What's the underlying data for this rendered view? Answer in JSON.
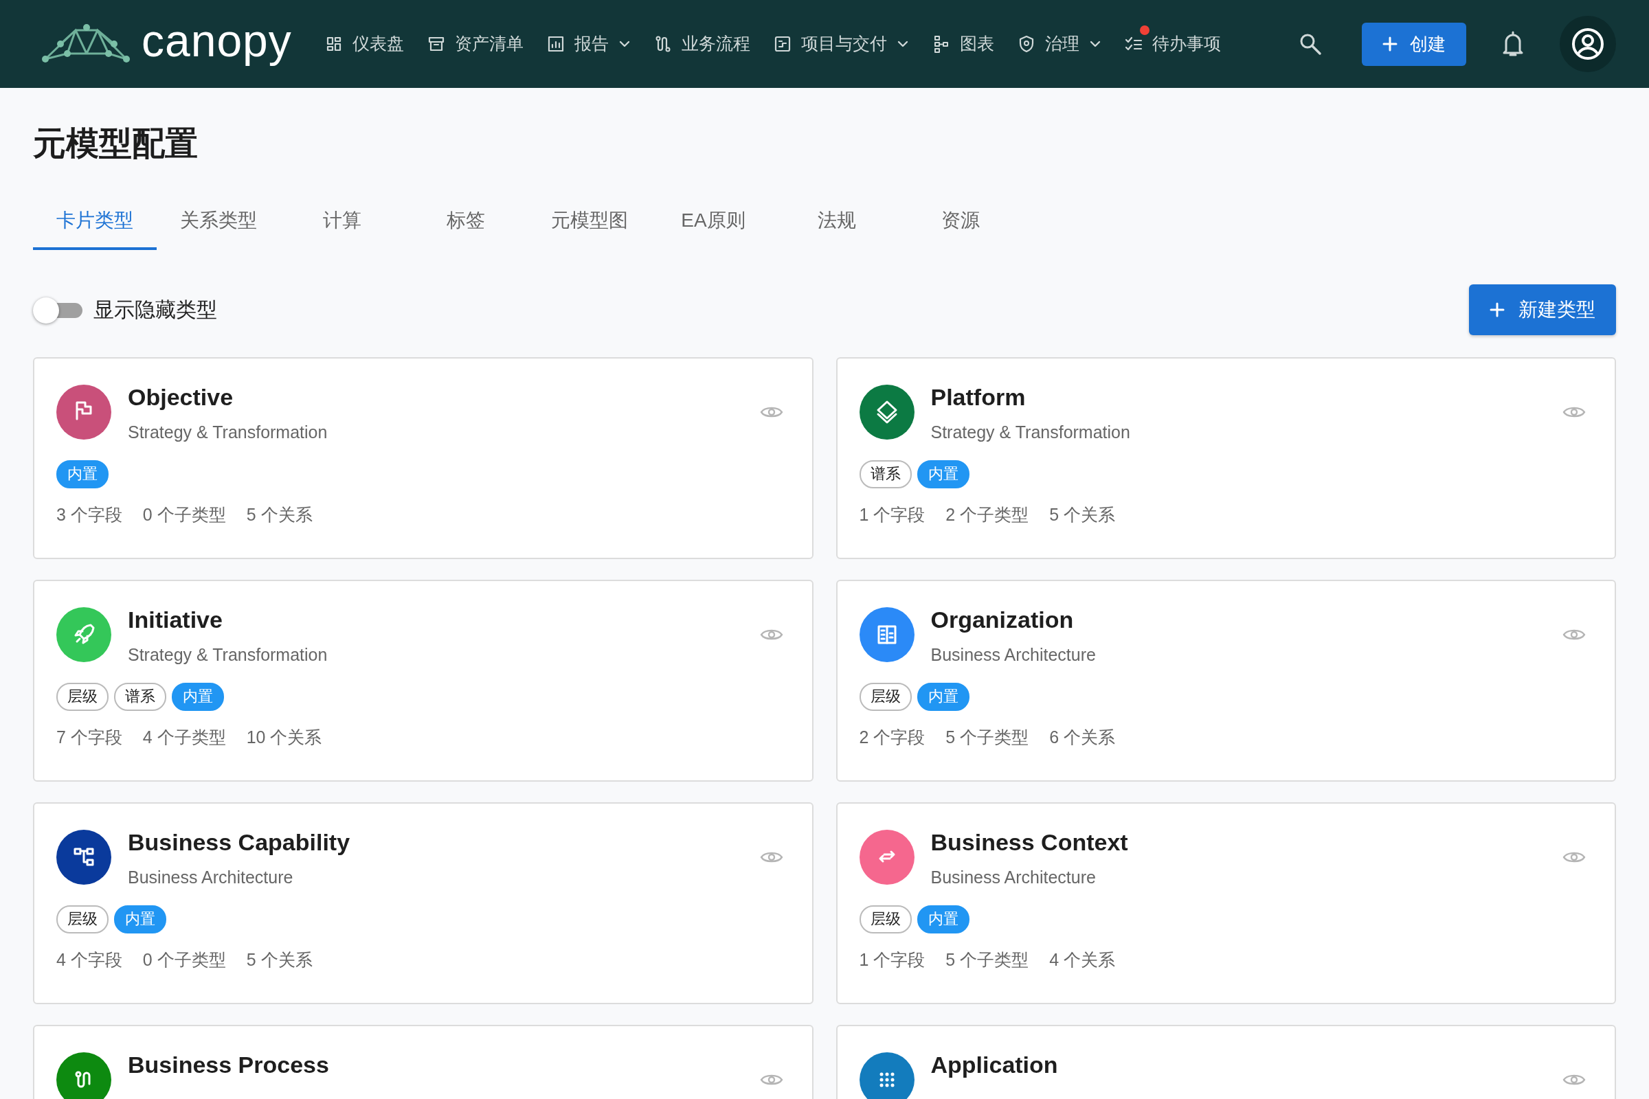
{
  "navbar": {
    "brand": "canopy",
    "items": [
      {
        "label": "仪表盘",
        "dropdown": false,
        "notification": false
      },
      {
        "label": "资产清单",
        "dropdown": false,
        "notification": false
      },
      {
        "label": "报告",
        "dropdown": true,
        "notification": false
      },
      {
        "label": "业务流程",
        "dropdown": false,
        "notification": false
      },
      {
        "label": "项目与交付",
        "dropdown": true,
        "notification": false
      },
      {
        "label": "图表",
        "dropdown": false,
        "notification": false
      },
      {
        "label": "治理",
        "dropdown": true,
        "notification": false
      },
      {
        "label": "待办事项",
        "dropdown": false,
        "notification": true
      }
    ],
    "create_button": "创建"
  },
  "page_title": "元模型配置",
  "tabs": [
    {
      "label": "卡片类型",
      "selected": true
    },
    {
      "label": "关系类型",
      "selected": false
    },
    {
      "label": "计算",
      "selected": false
    },
    {
      "label": "标签",
      "selected": false
    },
    {
      "label": "元模型图",
      "selected": false
    },
    {
      "label": "EA原则",
      "selected": false
    },
    {
      "label": "法规",
      "selected": false
    },
    {
      "label": "资源",
      "selected": false
    }
  ],
  "toggle": {
    "label": "显示隐藏类型",
    "on": false
  },
  "new_type_button": "新建类型",
  "cards": [
    {
      "title": "Objective",
      "subtitle": "Strategy & Transformation",
      "color": "#c9507a",
      "tags": [
        {
          "label": "内置",
          "kind": "filled"
        }
      ],
      "stats": [
        "3 个字段",
        "0 个子类型",
        "5 个关系"
      ]
    },
    {
      "title": "Platform",
      "subtitle": "Strategy & Transformation",
      "color": "#0c7a43",
      "tags": [
        {
          "label": "谱系",
          "kind": "outline"
        },
        {
          "label": "内置",
          "kind": "filled"
        }
      ],
      "stats": [
        "1 个字段",
        "2 个子类型",
        "5 个关系"
      ]
    },
    {
      "title": "Initiative",
      "subtitle": "Strategy & Transformation",
      "color": "#34c759",
      "tags": [
        {
          "label": "层级",
          "kind": "outline"
        },
        {
          "label": "谱系",
          "kind": "outline"
        },
        {
          "label": "内置",
          "kind": "filled"
        }
      ],
      "stats": [
        "7 个字段",
        "4 个子类型",
        "10 个关系"
      ]
    },
    {
      "title": "Organization",
      "subtitle": "Business Architecture",
      "color": "#2b8af7",
      "tags": [
        {
          "label": "层级",
          "kind": "outline"
        },
        {
          "label": "内置",
          "kind": "filled"
        }
      ],
      "stats": [
        "2 个字段",
        "5 个子类型",
        "6 个关系"
      ]
    },
    {
      "title": "Business Capability",
      "subtitle": "Business Architecture",
      "color": "#0a3a9c",
      "tags": [
        {
          "label": "层级",
          "kind": "outline"
        },
        {
          "label": "内置",
          "kind": "filled"
        }
      ],
      "stats": [
        "4 个字段",
        "0 个子类型",
        "5 个关系"
      ]
    },
    {
      "title": "Business Context",
      "subtitle": "Business Architecture",
      "color": "#f5678e",
      "tags": [
        {
          "label": "层级",
          "kind": "outline"
        },
        {
          "label": "内置",
          "kind": "filled"
        }
      ],
      "stats": [
        "1 个字段",
        "5 个子类型",
        "4 个关系"
      ]
    },
    {
      "title": "Business Process",
      "color": "#0d8a10"
    },
    {
      "title": "Application",
      "color": "#137cbd"
    }
  ]
}
